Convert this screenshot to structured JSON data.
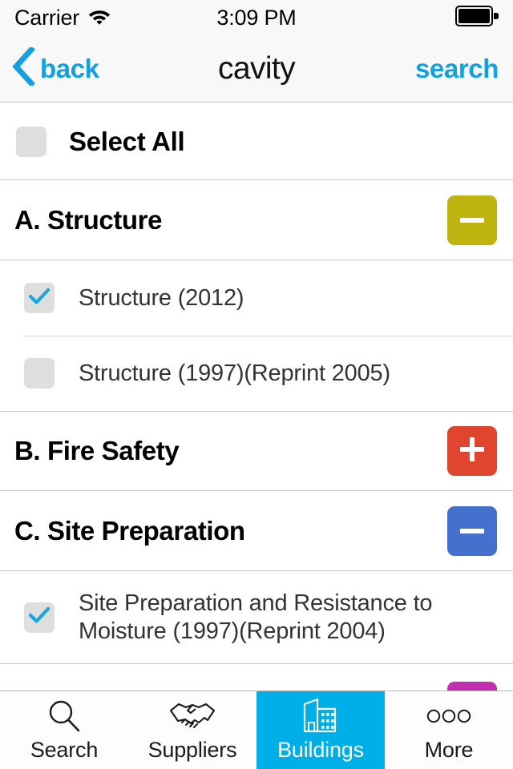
{
  "status_bar": {
    "carrier": "Carrier",
    "wifi_icon": "wifi-icon",
    "time": "3:09 PM",
    "battery_icon": "battery-full-icon"
  },
  "nav_bar": {
    "back_icon": "chevron-left-icon",
    "back_label": "back",
    "title": "cavity",
    "search_label": "search",
    "tint_color": "#14a0e0"
  },
  "list": {
    "select_all": {
      "label": "Select All",
      "checked": false,
      "checkbox_icon": "checkbox-unchecked-icon"
    },
    "sections": [
      {
        "title": "A. Structure",
        "expanded": true,
        "toggle_icon": "minus-icon",
        "toggle_label": "–",
        "toggle_color": "#bfb30f",
        "items": [
          {
            "label": "Structure (2012)",
            "checked": true,
            "checkbox_icon": "checkbox-checked-icon"
          },
          {
            "label": "Structure (1997)(Reprint 2005)",
            "checked": false,
            "checkbox_icon": "checkbox-unchecked-icon"
          }
        ]
      },
      {
        "title": "B. Fire Safety",
        "expanded": false,
        "toggle_icon": "plus-icon",
        "toggle_label": "+",
        "toggle_color": "#e0452f",
        "items": []
      },
      {
        "title": "C. Site Preparation",
        "expanded": true,
        "toggle_icon": "minus-icon",
        "toggle_label": "–",
        "toggle_color": "#4470ce",
        "items": [
          {
            "label": "Site Preparation and Resistance to Moisture (1997)(Reprint 2004)",
            "checked": true,
            "checkbox_icon": "checkbox-checked-icon"
          }
        ]
      }
    ],
    "next_section_partial": {
      "toggle_icon": "minus-icon",
      "toggle_color": "#c12fb0"
    },
    "checkbox_bg": "#dedede",
    "check_color": "#18a5e0"
  },
  "tab_bar": {
    "active_index": 2,
    "active_color": "#00aee8",
    "tabs": [
      {
        "label": "Search",
        "icon": "magnifier-icon"
      },
      {
        "label": "Suppliers",
        "icon": "handshake-icon"
      },
      {
        "label": "Buildings",
        "icon": "buildings-icon"
      },
      {
        "label": "More",
        "icon": "three-circles-icon"
      }
    ]
  }
}
